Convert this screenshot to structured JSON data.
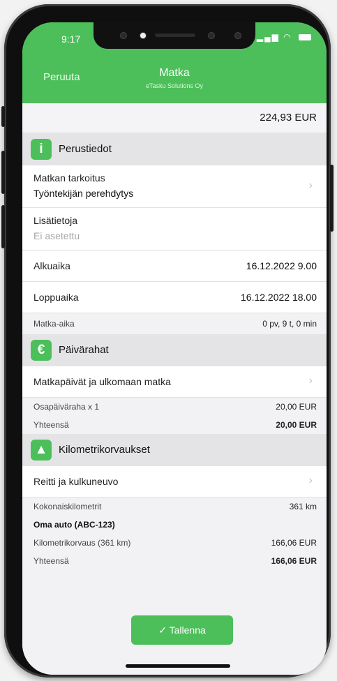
{
  "status": {
    "time": "9:17"
  },
  "nav": {
    "cancel": "Peruuta",
    "title": "Matka",
    "subtitle": "eTasku Solutions Oy"
  },
  "total": "224,93 EUR",
  "basic": {
    "icon": "info-icon",
    "title": "Perustiedot",
    "purpose_label": "Matkan tarkoitus",
    "purpose_value": "Työntekijän perehdytys",
    "extra_label": "Lisätietoja",
    "extra_value": "Ei asetettu",
    "start_label": "Alkuaika",
    "start_value": "16.12.2022 9.00",
    "end_label": "Loppuaika",
    "end_value": "16.12.2022 18.00",
    "duration_label": "Matka-aika",
    "duration_value": "0 pv, 9 t, 0 min"
  },
  "allowance": {
    "icon": "euro-icon",
    "title": "Päivärahat",
    "days_label": "Matkapäivät ja ulkomaan matka",
    "partial_label": "Osapäiväraha x 1",
    "partial_value": "20,00 EUR",
    "sum_label": "Yhteensä",
    "sum_value": "20,00 EUR"
  },
  "mileage": {
    "icon": "road-icon",
    "title": "Kilometrikorvaukset",
    "route_label": "Reitti ja kulkuneuvo",
    "km_label": "Kokonaiskilometrit",
    "km_value": "361 km",
    "car": "Oma auto (ABC-123)",
    "comp_label": "Kilometrikorvaus (361 km)",
    "comp_value": "166,06 EUR",
    "sum_label": "Yhteensä",
    "sum_value": "166,06 EUR"
  },
  "save_label": "Tallenna",
  "colors": {
    "accent": "#4cbf5a"
  }
}
